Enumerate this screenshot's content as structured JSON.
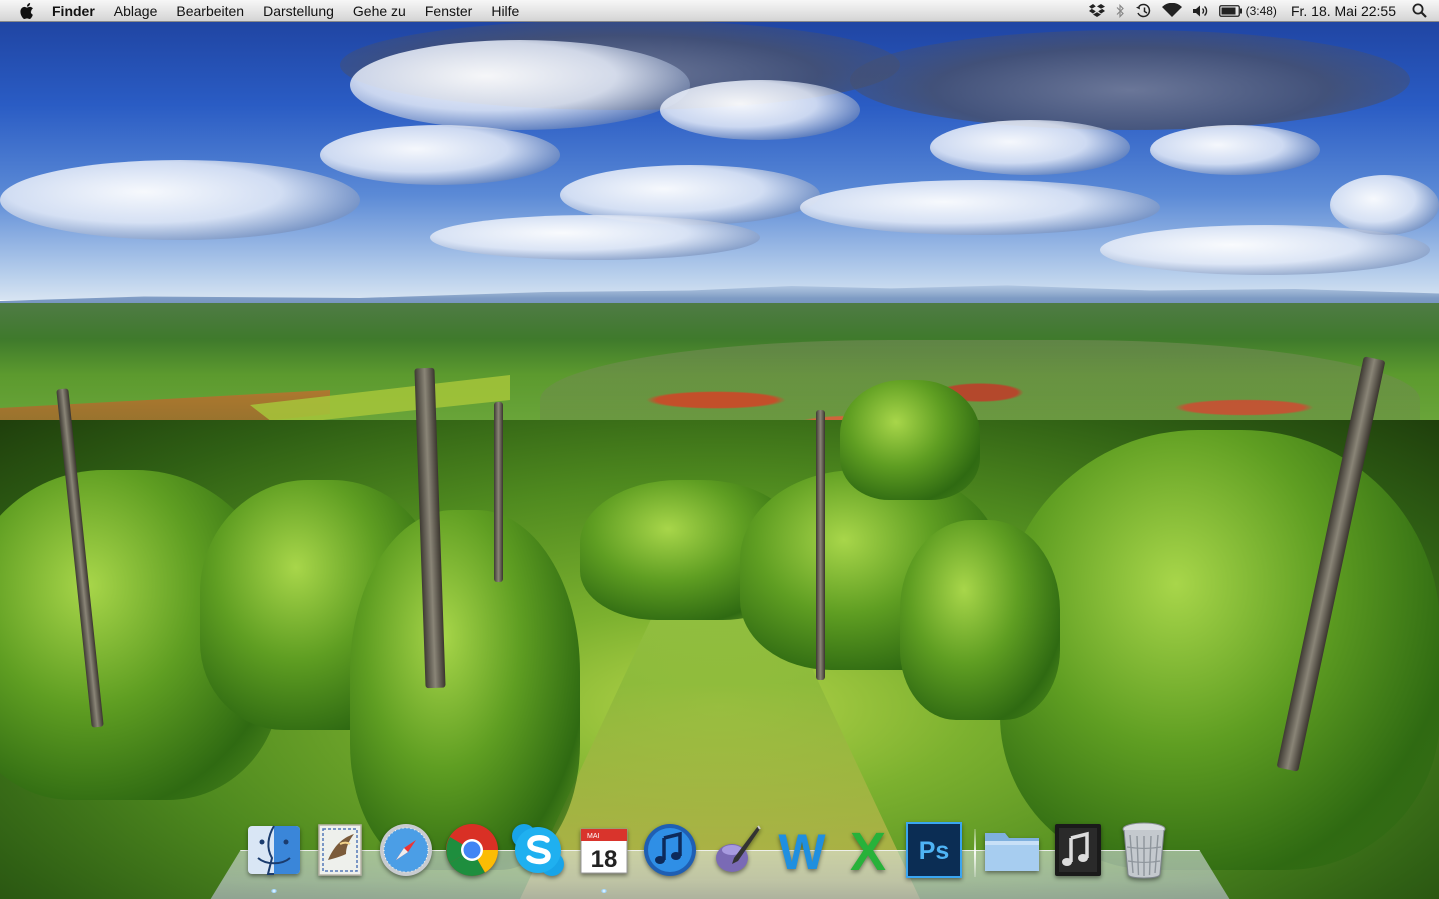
{
  "menubar": {
    "apple_icon": "apple-logo-icon",
    "app_name": "Finder",
    "menus": [
      "Ablage",
      "Bearbeiten",
      "Darstellung",
      "Gehe zu",
      "Fenster",
      "Hilfe"
    ],
    "status_icons": [
      "dropbox-icon",
      "bluetooth-icon",
      "time-machine-icon",
      "wifi-icon",
      "volume-icon",
      "battery-icon"
    ],
    "battery_time": "(3:48)",
    "clock": "Fr. 18. Mai  22:55",
    "spotlight_icon": "spotlight-search-icon"
  },
  "dock": {
    "items": [
      {
        "name": "finder",
        "icon": "finder-icon"
      },
      {
        "name": "mail",
        "icon": "mail-icon"
      },
      {
        "name": "safari",
        "icon": "safari-icon"
      },
      {
        "name": "chrome",
        "icon": "chrome-icon"
      },
      {
        "name": "skype",
        "icon": "skype-icon"
      },
      {
        "name": "ical",
        "icon": "calendar-icon",
        "calendar_month": "MAI",
        "calendar_day": "18"
      },
      {
        "name": "itunes",
        "icon": "itunes-icon"
      },
      {
        "name": "script-editor",
        "icon": "script-editor-icon"
      },
      {
        "name": "word",
        "icon": "word-icon",
        "glyph": "W"
      },
      {
        "name": "excel",
        "icon": "excel-icon",
        "glyph": "X"
      },
      {
        "name": "photoshop",
        "icon": "photoshop-icon",
        "glyph": "Ps"
      }
    ],
    "stacks": [
      {
        "name": "documents-stack",
        "icon": "folder-stack-icon"
      },
      {
        "name": "music-stack",
        "icon": "music-stack-icon"
      },
      {
        "name": "trash",
        "icon": "trash-icon"
      }
    ]
  },
  "colors": {
    "menubar_top": "#f7f7f7",
    "menubar_bottom": "#d4d4d4",
    "sky_top": "#1d3f9a",
    "vineyard_green": "#5f9e22"
  }
}
